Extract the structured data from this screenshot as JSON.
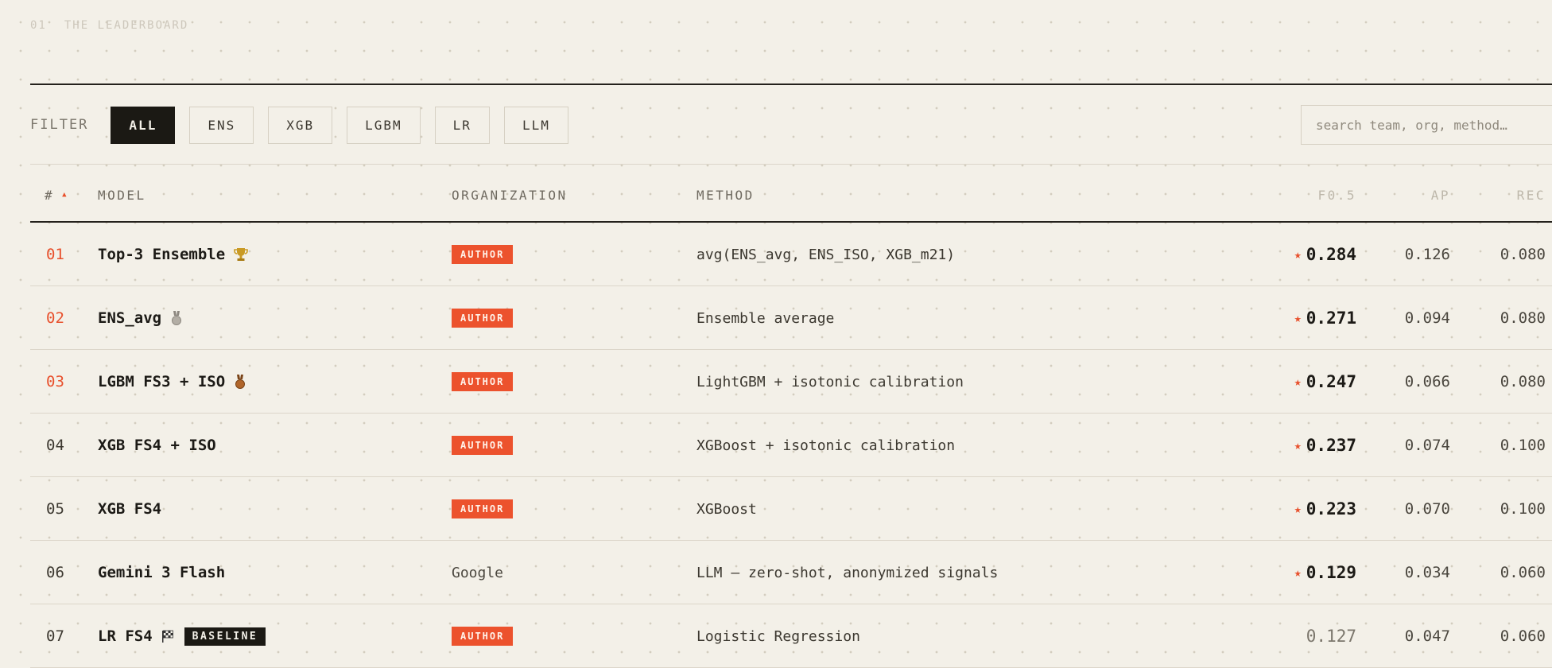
{
  "section": {
    "number": "01",
    "title": "THE LEADERBOARD"
  },
  "filter": {
    "label": "FILTER",
    "chips": [
      "ALL",
      "ENS",
      "XGB",
      "LGBM",
      "LR",
      "LLM"
    ],
    "active": "ALL",
    "search_placeholder": "search team, org, method…"
  },
  "table": {
    "headers": {
      "num": "#",
      "model": "MODEL",
      "organization": "ORGANIZATION",
      "method": "METHOD",
      "f05": "F0.5",
      "ap": "AP",
      "rec": "REC"
    },
    "sort_indicator": "▲",
    "rows": [
      {
        "rank": "01",
        "model": "Top-3 Ensemble",
        "icon": "trophy-icon",
        "org": "AUTHOR",
        "org_is_badge": true,
        "method": "avg(ENS_avg, ENS_ISO, XGB_m21)",
        "starred": true,
        "f05": "0.284",
        "ap": "0.126",
        "rec": "0.080",
        "top": true
      },
      {
        "rank": "02",
        "model": "ENS_avg",
        "icon": "silver-medal-icon",
        "org": "AUTHOR",
        "org_is_badge": true,
        "method": "Ensemble average",
        "starred": true,
        "f05": "0.271",
        "ap": "0.094",
        "rec": "0.080",
        "top": true
      },
      {
        "rank": "03",
        "model": "LGBM FS3 + ISO",
        "icon": "bronze-medal-icon",
        "org": "AUTHOR",
        "org_is_badge": true,
        "method": "LightGBM + isotonic calibration",
        "starred": true,
        "f05": "0.247",
        "ap": "0.066",
        "rec": "0.080",
        "top": true
      },
      {
        "rank": "04",
        "model": "XGB FS4 + ISO",
        "icon": "",
        "org": "AUTHOR",
        "org_is_badge": true,
        "method": "XGBoost + isotonic calibration",
        "starred": true,
        "f05": "0.237",
        "ap": "0.074",
        "rec": "0.100",
        "top": false
      },
      {
        "rank": "05",
        "model": "XGB FS4",
        "icon": "",
        "org": "AUTHOR",
        "org_is_badge": true,
        "method": "XGBoost",
        "starred": true,
        "f05": "0.223",
        "ap": "0.070",
        "rec": "0.100",
        "top": false
      },
      {
        "rank": "06",
        "model": "Gemini 3 Flash",
        "icon": "",
        "org": "Google",
        "org_is_badge": false,
        "method": "LLM — zero-shot, anonymized signals",
        "starred": true,
        "f05": "0.129",
        "ap": "0.034",
        "rec": "0.060",
        "top": false
      },
      {
        "rank": "07",
        "model": "LR FS4",
        "icon": "checkered-flag-icon",
        "badge": "BASELINE",
        "org": "AUTHOR",
        "org_is_badge": true,
        "method": "Logistic Regression",
        "starred": false,
        "f05": "0.127",
        "ap": "0.047",
        "rec": "0.060",
        "top": false
      }
    ]
  },
  "colors": {
    "accent": "#e8502c",
    "ink": "#1b1914",
    "paper": "#f3f0e8"
  }
}
